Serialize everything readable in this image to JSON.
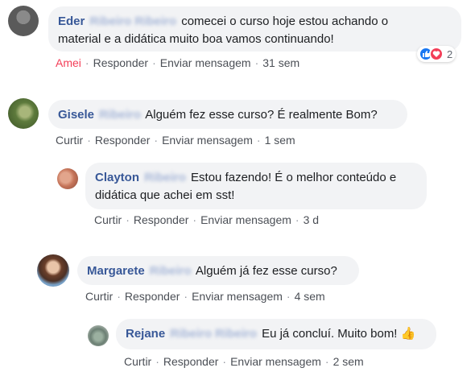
{
  "comments": [
    {
      "author": "Eder",
      "author_hidden": "Ribeiro Ribeiro",
      "text_line1": "comecei o curso hoje estou achando o",
      "text_line2": "material e a didática muito boa vamos continuando!",
      "actions": {
        "like": "Amei",
        "reply": "Responder",
        "message": "Enviar mensagem",
        "time": "31 sem"
      },
      "reactions": {
        "count": "2"
      }
    },
    {
      "author": "Gisele",
      "author_hidden": "Ribeiro",
      "text": "Alguém fez esse curso? É realmente Bom?",
      "actions": {
        "like": "Curtir",
        "reply": "Responder",
        "message": "Enviar mensagem",
        "time": "1 sem"
      }
    },
    {
      "author": "Clayton",
      "author_hidden": "Ribeiro",
      "text_line1": "Estou fazendo! É o melhor conteúdo e",
      "text_line2": "didática que achei em sst!",
      "actions": {
        "like": "Curtir",
        "reply": "Responder",
        "message": "Enviar mensagem",
        "time": "3 d"
      }
    },
    {
      "author": "Margarete",
      "author_hidden": "Ribeiro",
      "text": "Alguém já fez esse curso?",
      "actions": {
        "like": "Curtir",
        "reply": "Responder",
        "message": "Enviar mensagem",
        "time": "4 sem"
      }
    },
    {
      "author": "Rejane",
      "author_hidden": "Ribeiro Ribeiro",
      "text": "Eu já concluí. Muito bom!",
      "emoji": "👍",
      "actions": {
        "like": "Curtir",
        "reply": "Responder",
        "message": "Enviar mensagem",
        "time": "2 sem"
      }
    }
  ],
  "separator": "·",
  "colors": {
    "author": "#385898",
    "bubble": "#f2f3f5",
    "love": "#f33e58",
    "like": "#1877f2"
  }
}
